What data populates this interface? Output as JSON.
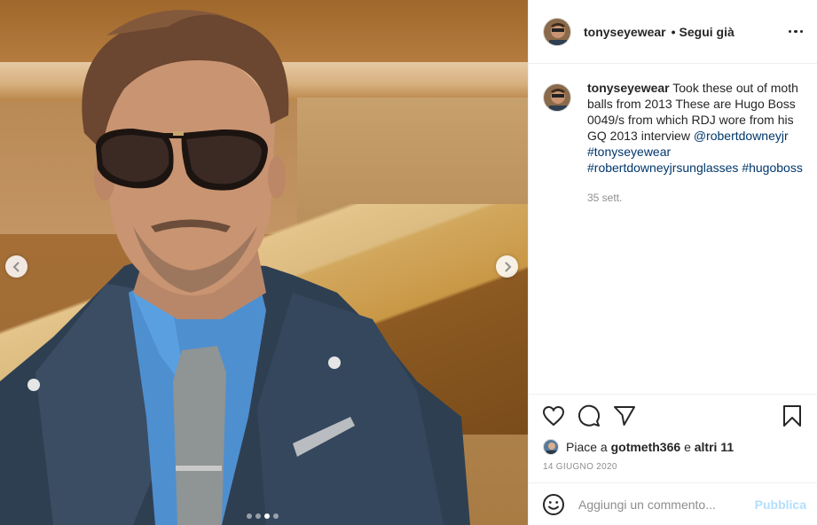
{
  "post": {
    "username": "tonyseyewear",
    "separator": "•",
    "follow_label": "Segui già",
    "more_icon": "more-horizontal-icon"
  },
  "media": {
    "prev_icon": "chevron-left-icon",
    "next_icon": "chevron-right-icon",
    "slides": 4,
    "active_slide": 3
  },
  "caption": {
    "author": "tonyseyewear",
    "text": "Took these out of moth balls from 2013 These are Hugo Boss 0049/s from which RDJ wore from his GQ 2013 interview",
    "mention": "@robertdowneyjr",
    "tags": [
      "#tonyseyewear",
      "#robertdowneyjrsunglasses",
      "#hugoboss"
    ],
    "time": "35 sett."
  },
  "actions": {
    "like_icon": "heart-icon",
    "comment_icon": "comment-icon",
    "share_icon": "paper-plane-icon",
    "save_icon": "bookmark-icon"
  },
  "likes": {
    "prefix": "Piace a",
    "user": "gotmeth366",
    "joiner": "e",
    "others": "altri 11"
  },
  "date": "14 giugno 2020",
  "comment": {
    "emoji_icon": "smiley-icon",
    "placeholder": "Aggiungi un commento...",
    "publish_label": "Pubblica"
  },
  "colors": {
    "link": "#00376b",
    "muted": "#8e8e8e",
    "publish_disabled": "#b2dffc",
    "border": "#efefef"
  }
}
